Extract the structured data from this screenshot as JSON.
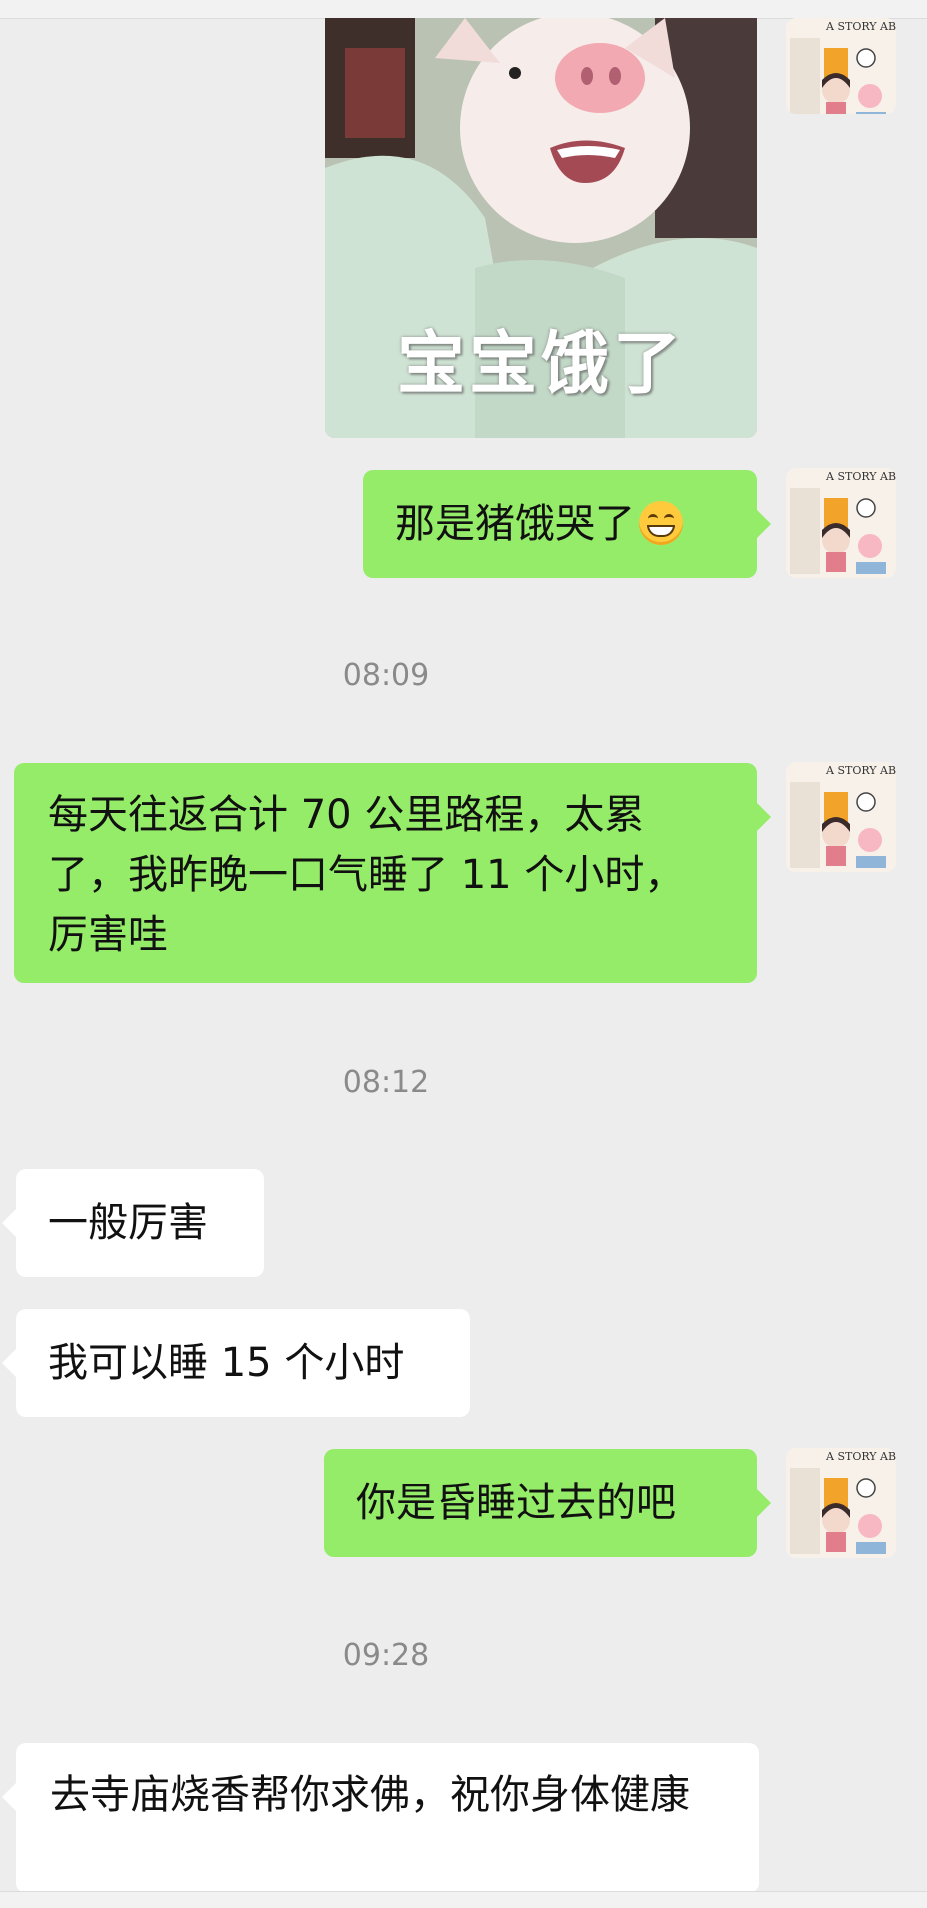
{
  "sticker": {
    "caption": "宝宝饿了"
  },
  "avatar": {
    "icon": "illustrated-girl-avatar-icon",
    "text": "A STORY ABOUT"
  },
  "messages": [
    {
      "side": "me",
      "text": "那是猪饿哭了",
      "emoji": "grinning-face-icon"
    },
    {
      "side": "me",
      "text": "每天往返合计 70 公里路程，太累了，我昨晚一口气睡了 11 个小时，厉害哇"
    },
    {
      "side": "other",
      "text": "一般厉害"
    },
    {
      "side": "other",
      "text": "我可以睡 15 个小时"
    },
    {
      "side": "me",
      "text": "你是昏睡过去的吧"
    },
    {
      "side": "other",
      "text": "去寺庙烧香帮你求佛，祝你身体健康"
    }
  ],
  "timestamps": [
    "08:09",
    "08:12",
    "09:28"
  ],
  "colors": {
    "background": "#ededed",
    "me_bubble": "#95ec69",
    "other_bubble": "#ffffff",
    "timestamp": "#8a8a8a"
  }
}
